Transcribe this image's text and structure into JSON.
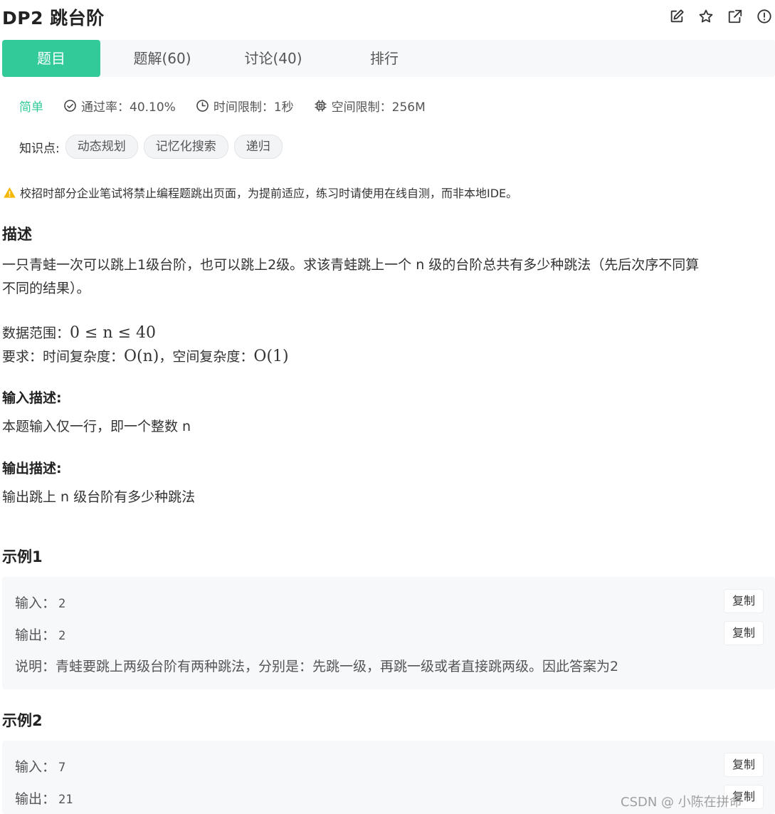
{
  "title": "DP2  跳台阶",
  "title_icons": [
    "edit-icon",
    "star-icon",
    "external-link-icon",
    "report-icon"
  ],
  "tabs": [
    {
      "label": "题目",
      "active": true
    },
    {
      "label": "题解(60)"
    },
    {
      "label": "讨论(40)"
    },
    {
      "label": "排行"
    }
  ],
  "meta": {
    "difficulty": "简单",
    "pass_rate": "通过率：40.10%",
    "time_limit": "时间限制：1秒",
    "space_limit": "空间限制：256M"
  },
  "knowledge": {
    "label": "知识点:",
    "tags": [
      "动态规划",
      "记忆化搜索",
      "递归"
    ]
  },
  "warning": "校招时部分企业笔试将禁止编程题跳出页面，为提前适应，练习时请使用在线自测，而非本地IDE。",
  "description": {
    "heading": "描述",
    "line1": "一只青蛙一次可以跳上1级台阶，也可以跳上2级。求该青蛙跳上一个 n 级的台阶总共有多少种跳法（先后次序不同算",
    "line2": "不同的结果）。",
    "range_label": "数据范围：",
    "range_math": "0 ≤ n ≤ 40",
    "req_label": "要求：时间复杂度：",
    "req_time": "O(n)",
    "req_mid": "，空间复杂度：",
    "req_space": "O(1)"
  },
  "input_desc": {
    "heading": "输入描述:",
    "text": "本题输入仅一行，即一个整数 n"
  },
  "output_desc": {
    "heading": "输出描述:",
    "text": "输出跳上 n 级台阶有多少种跳法"
  },
  "examples": [
    {
      "heading": "示例1",
      "input_label": "输入：",
      "input": "2",
      "output_label": "输出：",
      "output": "2",
      "note_label": "说明：",
      "note": "青蛙要跳上两级台阶有两种跳法，分别是：先跳一级，再跳一级或者直接跳两级。因此答案为2"
    },
    {
      "heading": "示例2",
      "input_label": "输入：",
      "input": "7",
      "output_label": "输出：",
      "output": "21"
    }
  ],
  "copy_label": "复制",
  "watermark": "CSDN @  小陈在拼命",
  "colors": {
    "accent": "#32ca99",
    "warning": "#f5b800",
    "panel": "#f7f8fa"
  }
}
